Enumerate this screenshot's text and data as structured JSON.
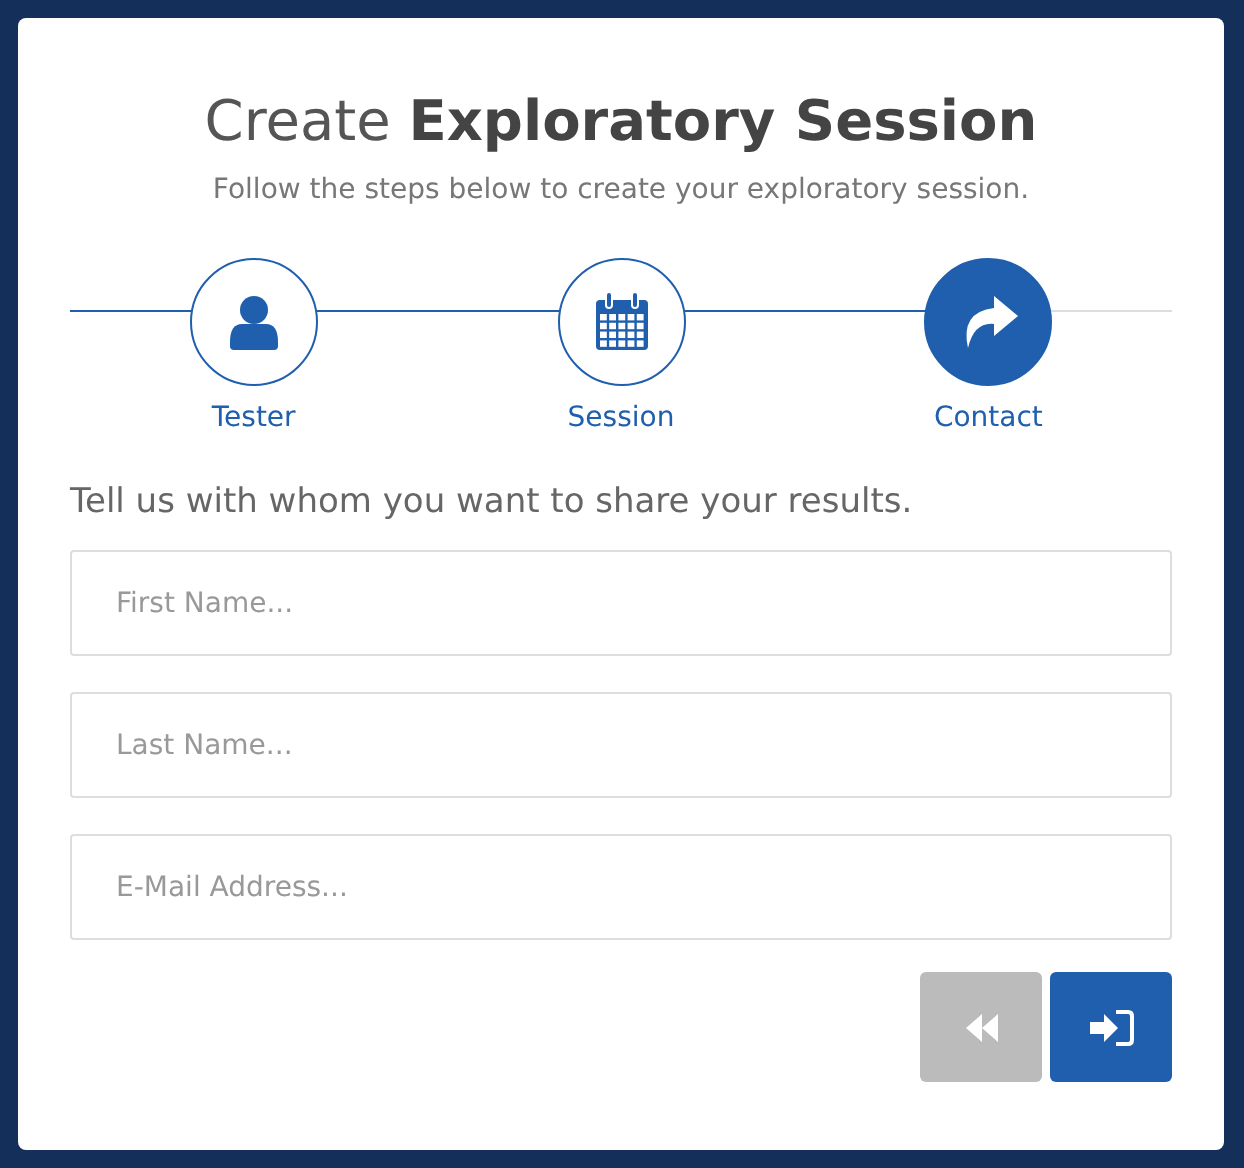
{
  "title": "Create **Exploratory Session**",
  "subtitle": "Follow the steps below to create your exploratory session.",
  "steps": [
    {
      "label": "Tester",
      "kind": "person",
      "selected": false
    },
    {
      "label": "Session",
      "kind": "calendar",
      "selected": false
    },
    {
      "label": "Contact",
      "kind": "share",
      "selected": true
    }
  ],
  "prompt": "Tell us with whom you want to share your results.",
  "fields": [
    {
      "placeholder": "First Name..."
    },
    {
      "placeholder": "Last Name..."
    },
    {
      "placeholder": "E-Mail Address..."
    }
  ],
  "buttons": [
    {
      "kind": "back",
      "disabled": true
    },
    {
      "kind": "submit",
      "disabled": false
    }
  ]
}
